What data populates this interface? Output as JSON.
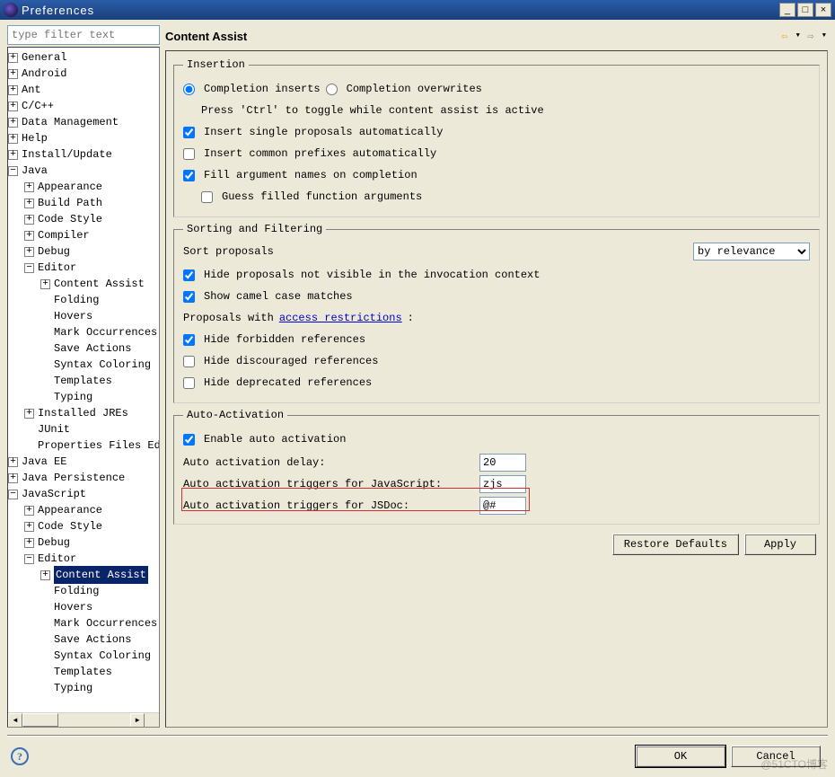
{
  "window": {
    "title": "Preferences"
  },
  "filter": {
    "placeholder": "type filter text"
  },
  "tree": {
    "General": "General",
    "Android": "Android",
    "Ant": "Ant",
    "CCpp": "C/C++",
    "DataManagement": "Data Management",
    "Help": "Help",
    "InstallUpdate": "Install/Update",
    "Java": "Java",
    "Java_Appearance": "Appearance",
    "Java_BuildPath": "Build Path",
    "Java_CodeStyle": "Code Style",
    "Java_Compiler": "Compiler",
    "Java_Debug": "Debug",
    "Java_Editor": "Editor",
    "Java_Editor_ContentAssist": "Content Assist",
    "Java_Editor_Folding": "Folding",
    "Java_Editor_Hovers": "Hovers",
    "Java_Editor_MarkOccurrences": "Mark Occurrences",
    "Java_Editor_SaveActions": "Save Actions",
    "Java_Editor_SyntaxColoring": "Syntax Coloring",
    "Java_Editor_Templates": "Templates",
    "Java_Editor_Typing": "Typing",
    "Java_InstalledJREs": "Installed JREs",
    "Java_JUnit": "JUnit",
    "Java_PropertiesFiles": "Properties Files Editor",
    "JavaEE": "Java EE",
    "JavaPersistence": "Java Persistence",
    "JavaScript": "JavaScript",
    "JS_Appearance": "Appearance",
    "JS_CodeStyle": "Code Style",
    "JS_Debug": "Debug",
    "JS_Editor": "Editor",
    "JS_Editor_ContentAssist": "Content Assist",
    "JS_Editor_Folding": "Folding",
    "JS_Editor_Hovers": "Hovers",
    "JS_Editor_MarkOccurrences": "Mark Occurrences",
    "JS_Editor_SaveActions": "Save Actions",
    "JS_Editor_SyntaxColoring": "Syntax Coloring",
    "JS_Editor_Templates": "Templates",
    "JS_Editor_Typing": "Typing"
  },
  "page": {
    "title": "Content Assist",
    "insertion": {
      "legend": "Insertion",
      "radio_inserts": "Completion inserts",
      "radio_overwrites": "Completion overwrites",
      "press_ctrl": "Press 'Ctrl' to toggle while content assist is active",
      "insert_single": "Insert single proposals automatically",
      "insert_common": "Insert common prefixes automatically",
      "fill_args": "Fill argument names on completion",
      "guess_args": "Guess filled function arguments"
    },
    "sorting": {
      "legend": "Sorting and Filtering",
      "sort_label": "Sort proposals",
      "sort_value": "by relevance",
      "hide_invis": "Hide proposals not visible in the invocation context",
      "camel": "Show camel case matches",
      "proposals_with": "Proposals with ",
      "access_link": "access restrictions",
      "colon": ":",
      "hide_forbidden": "Hide forbidden references",
      "hide_discouraged": "Hide discouraged references",
      "hide_deprecated": "Hide deprecated references"
    },
    "auto": {
      "legend": "Auto-Activation",
      "enable": "Enable auto activation",
      "delay_label": "Auto activation delay:",
      "delay_value": "20",
      "triggers_js_label": "Auto activation triggers for JavaScript:",
      "triggers_js_value": "zjs",
      "triggers_jsdoc_label": "Auto activation triggers for JSDoc:",
      "triggers_jsdoc_value": "@#"
    },
    "buttons": {
      "restore": "Restore Defaults",
      "apply": "Apply",
      "ok": "OK",
      "cancel": "Cancel"
    }
  },
  "watermark": "@51CTO博客"
}
